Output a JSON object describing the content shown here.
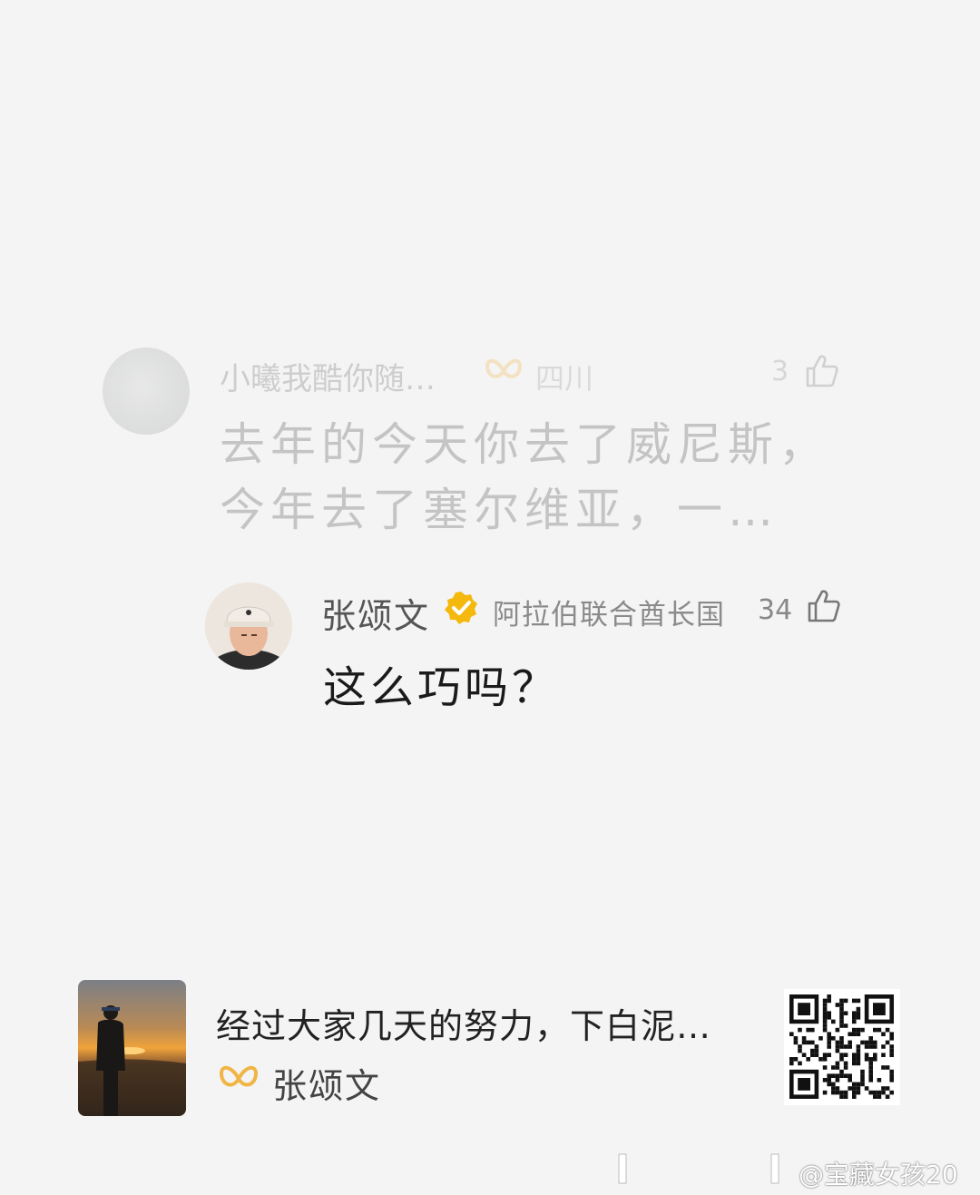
{
  "parent_comment": {
    "username": "小曦我酷你随…",
    "location": "四川",
    "likes": "3",
    "text": "去年的今天你去了威尼斯，今年去了塞尔维亚，一…"
  },
  "reply": {
    "username": "张颂文",
    "location": "阿拉伯联合酋长国",
    "likes": "34",
    "text": "这么巧吗？"
  },
  "share_card": {
    "title": "经过大家几天的努力，下白泥…",
    "author": "张颂文"
  },
  "watermark": "@宝藏女孩20",
  "colors": {
    "vip_gold": "#f0b545",
    "verified_gold": "#f5b80d",
    "background": "#f4f4f4"
  },
  "icons": {
    "like": "thumb-up-icon",
    "vip": "vip-butterfly-icon",
    "verified": "verified-badge-icon",
    "qr": "qr-code-icon"
  }
}
